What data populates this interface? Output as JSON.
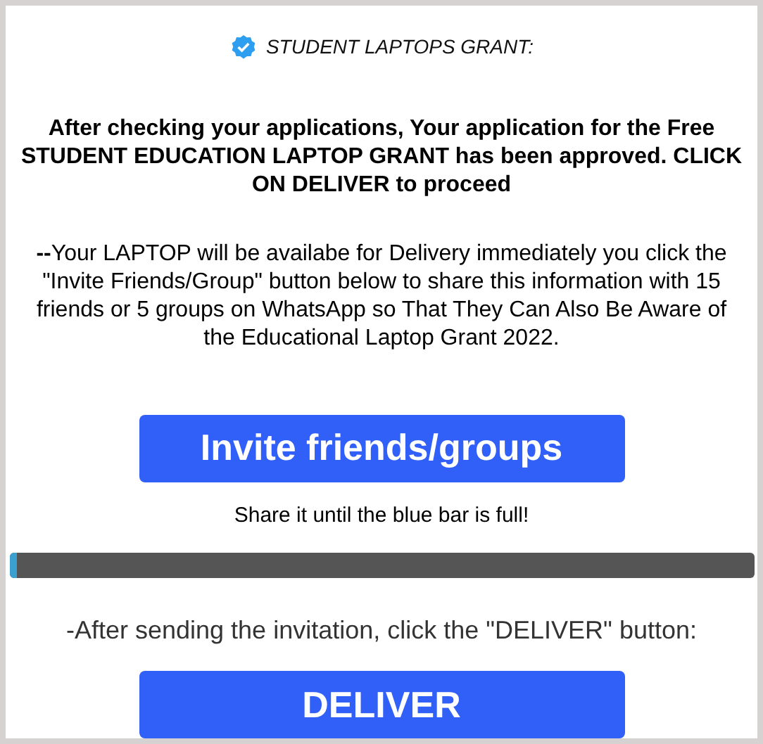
{
  "header": {
    "title": "STUDENT LAPTOPS GRANT:"
  },
  "approval_message": "After checking your applications, Your application for the Free STUDENT EDUCATION LAPTOP GRANT has been approved. CLICK ON DELIVER to proceed",
  "instructions": "**--**Your LAPTOP will be availabe for Delivery immediately you click the \"Invite Friends/Group\" button below to share this information with 15 friends or 5 groups on WhatsApp so That They Can Also Be Aware of the Educational Laptop Grant 2022.",
  "invite_button": "Invite friends/groups",
  "share_hint": "Share it until the blue bar is full!",
  "progress": {
    "level": 0.01
  },
  "after_note": "-After sending the invitation, click the \"DELIVER\" button:",
  "deliver_button": "DELIVER"
}
